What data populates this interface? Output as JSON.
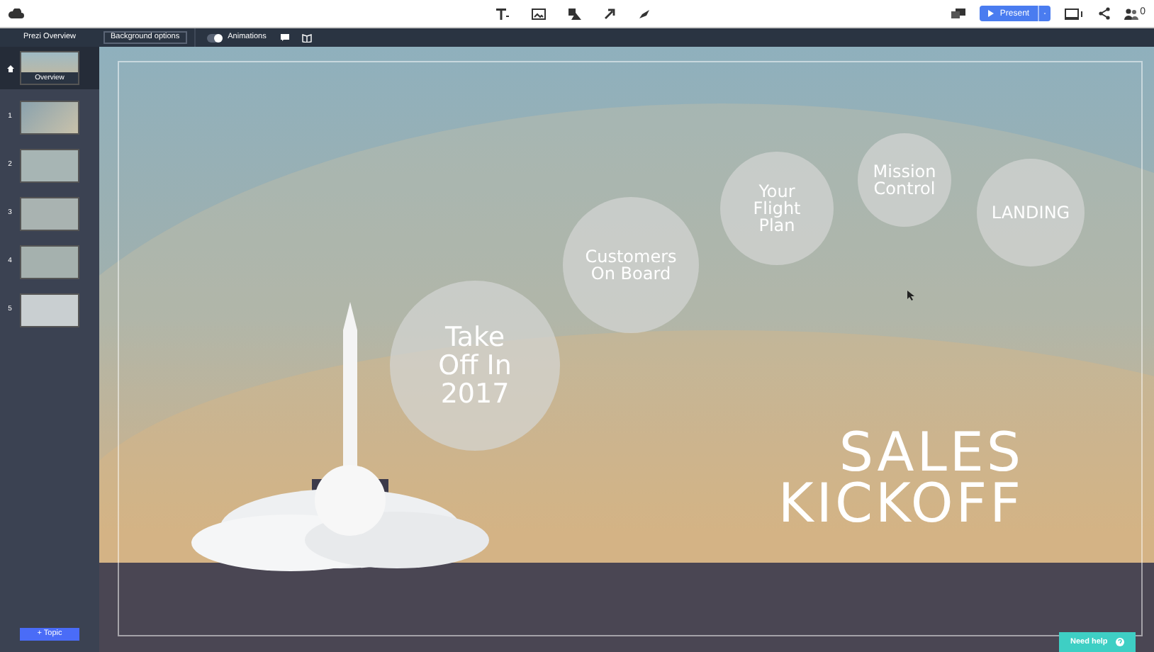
{
  "top_bar": {
    "present_button": "Present",
    "collaborators_count": "0"
  },
  "sub_bar": {
    "overview_tab": "Prezi Overview",
    "background_button": "Background options",
    "animations": {
      "label": "Animations",
      "on": true
    }
  },
  "sidebar": {
    "overview": {
      "label": "Overview",
      "selected": true
    },
    "slides": [
      {
        "number": "1",
        "selected": false
      },
      {
        "number": "2",
        "selected": false
      },
      {
        "number": "3",
        "selected": false
      },
      {
        "number": "4",
        "selected": false
      },
      {
        "number": "5",
        "selected": false
      }
    ],
    "add_button": "+ Topic"
  },
  "canvas": {
    "topics": [
      {
        "label": "Take Off In 2017"
      },
      {
        "label": "Customers On Board"
      },
      {
        "label": "Your Flight Plan"
      },
      {
        "label": "Mission Control"
      },
      {
        "label": "LANDING"
      }
    ],
    "title_lines": [
      "SALES",
      "KICKOFF"
    ]
  },
  "help_button": "Need help"
}
